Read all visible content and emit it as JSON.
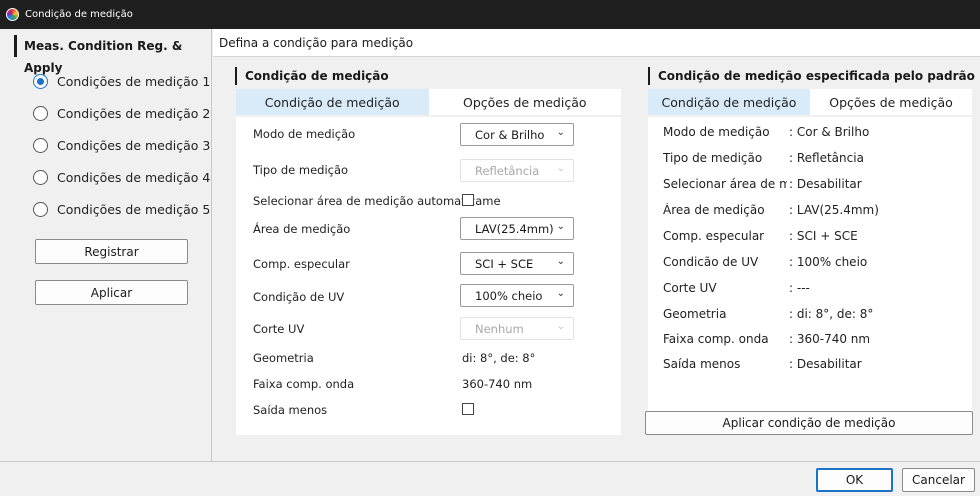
{
  "window": {
    "title": "Condição de medição"
  },
  "left": {
    "header": "Meas. Condition Reg. & Apply",
    "items": [
      {
        "label": "Condições de medição 1",
        "checked": true
      },
      {
        "label": "Condições de medição 2",
        "checked": false
      },
      {
        "label": "Condições de medição 3",
        "checked": false
      },
      {
        "label": "Condições de medição 4",
        "checked": false
      },
      {
        "label": "Condições de medição 5",
        "checked": false
      }
    ],
    "register_label": "Registrar",
    "apply_label": "Aplicar"
  },
  "content": {
    "header": "Defina a condição para medição",
    "condition": {
      "title": "Condição de medição",
      "tabs": [
        {
          "label": "Condição de medição",
          "active": true
        },
        {
          "label": "Opções de medição",
          "active": false
        }
      ],
      "rows": {
        "mode": {
          "label": "Modo de medição",
          "value": "Cor & Brilho"
        },
        "type": {
          "label": "Tipo de medição",
          "value": "Refletância"
        },
        "auto_area": {
          "label": "Selecionar área de medição automaticame",
          "checked": false
        },
        "area": {
          "label": "Área de medição",
          "value": "LAV(25.4mm)"
        },
        "specular": {
          "label": "Comp. especular",
          "value": "SCI + SCE"
        },
        "uv": {
          "label": "Condição de UV",
          "value": "100% cheio"
        },
        "uv_cut": {
          "label": "Corte UV",
          "value": "Nenhum"
        },
        "geometry": {
          "label": "Geometria",
          "value": "di: 8°, de: 8°"
        },
        "wavelength": {
          "label": "Faixa comp. onda",
          "value": "360-740 nm"
        },
        "minus_output": {
          "label": "Saída menos",
          "checked": false
        }
      }
    },
    "standard": {
      "title": "Condição de medição especificada pelo padrão",
      "tabs": [
        {
          "label": "Condição de medição",
          "active": true
        },
        {
          "label": "Opções de medição",
          "active": false
        }
      ],
      "rows": [
        {
          "label": "Modo de medição",
          "value": ": Cor & Brilho"
        },
        {
          "label": "Tipo de medição",
          "value": ": Refletância"
        },
        {
          "label": "Selecionar área de medição automaticamente",
          "value": ": Desabilitar"
        },
        {
          "label": "Área de medição",
          "value": ": LAV(25.4mm)"
        },
        {
          "label": "Comp. especular",
          "value": ": SCI + SCE"
        },
        {
          "label": "Condicão de UV",
          "value": ": 100% cheio"
        },
        {
          "label": "Corte UV",
          "value": ": ---"
        },
        {
          "label": "Geometria",
          "value": ": di: 8°, de: 8°"
        },
        {
          "label": "Faixa comp. onda",
          "value": ": 360-740 nm"
        },
        {
          "label": "Saída menos",
          "value": ": Desabilitar"
        }
      ],
      "apply_label": "Aplicar condição de medição"
    }
  },
  "footer": {
    "ok_label": "OK",
    "cancel_label": "Cancelar"
  },
  "icons": {
    "dropdown": "chevron-down-icon",
    "app": "color-wheel-icon"
  }
}
